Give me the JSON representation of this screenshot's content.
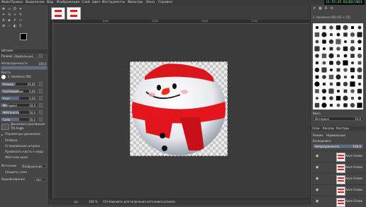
{
  "menubar": {
    "items": [
      "Файл",
      "Правка",
      "Выделение",
      "Вид",
      "Изображение",
      "Слой",
      "Цвет",
      "Инструменты",
      "Фильтры",
      "Окна",
      "Справка"
    ],
    "clock": "11:55:35  01/02/2021"
  },
  "toolbox": {
    "tool_options_title": "Штамп",
    "mode_label": "Режим",
    "mode_value": "Нормальный",
    "opacity_label": "Непрозрачность",
    "opacity_value": "100,0",
    "opacity_level": 1.0,
    "brush_label": "Кисть",
    "brush_value": "2. Hardness 050",
    "size_label": "Размер",
    "size_value": "29,00",
    "ratio_label": "Соотношение",
    "ratio_value": "0,00",
    "angle_label": "Угол",
    "angle_value": "0,00",
    "spacing_label": "Интервал",
    "spacing_value": "10,0",
    "hardness_label": "Жёсткость",
    "hardness_value": "50,0",
    "force_label": "Сила",
    "force_value": "50,0",
    "dynamics_label": "Динамика рисования",
    "dynamics_value": "Tilt Angle",
    "dynamics_params_label": "Параметры динамики",
    "jitter_label": "Разброс",
    "smooth_label": "Сглаживание штриха",
    "lock_brush_label": "Привязать кисть к виду",
    "hard_edge_label": "Жёсткие края",
    "source_label": "Источник",
    "source_value": "Изображение",
    "sample_merged_label": "Сводить слои",
    "alignment_label": "Выравнивание",
    "alignment_value": "Нет"
  },
  "canvas": {
    "ruler_ticks": [
      "1000",
      "1250",
      "1500",
      "1750"
    ]
  },
  "statusbar": {
    "unit": "px",
    "zoom": "100 %",
    "message": "Ctrl-Нажмите для получения источника штампа"
  },
  "rightpanel": {
    "brush_title": "2. Hardness 050 (51 × 51)",
    "filter_label": "Basic,",
    "spacing_label": "Интервал",
    "spacing_value": "10,0",
    "tabs": [
      "Слои",
      "Каналы",
      "Контуры"
    ],
    "mode_label": "Режим",
    "mode_value": "Нормальный",
    "lock_label": "Блокировка:",
    "opacity_label": "Непрозрачность",
    "opacity_value": "100,0",
    "layers": [
      "Anim Frame",
      "Anim Frame",
      "Anim Frame",
      "Anim Frame",
      "Anim Frame"
    ]
  },
  "colors": {
    "background": "#454545",
    "panel": "#3a3a3a",
    "slider_fill": "#5d6f86",
    "clock_text": "#7cffa0"
  }
}
